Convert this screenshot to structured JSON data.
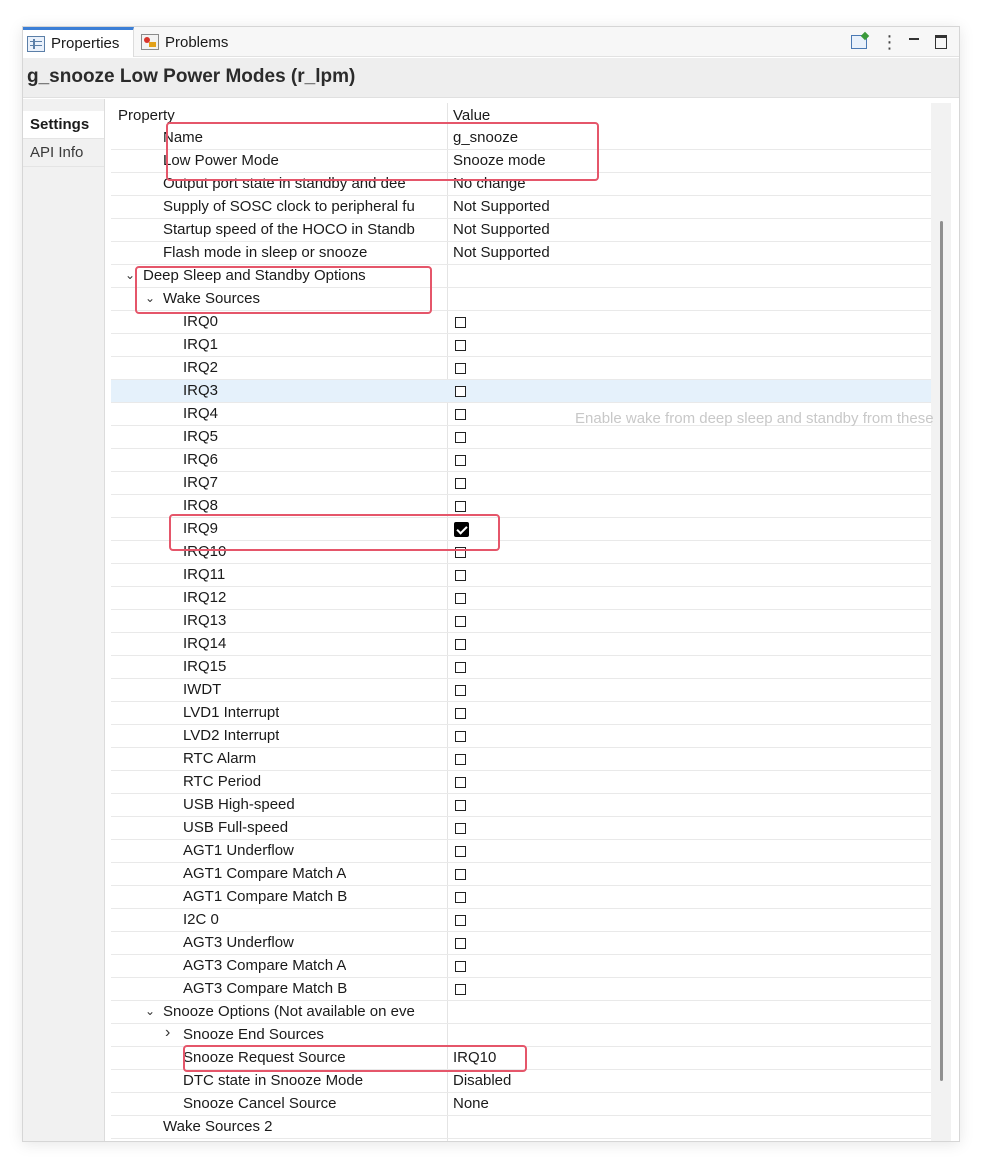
{
  "tabs": [
    {
      "label": "Properties",
      "active": true
    },
    {
      "label": "Problems",
      "active": false
    }
  ],
  "toolbar_icons": [
    "pin-to-editor-icon",
    "view-menu-icon",
    "minimize-icon",
    "maximize-icon"
  ],
  "header": {
    "title": "g_snooze Low Power Modes (r_lpm)"
  },
  "side_tabs": [
    {
      "label": "Settings",
      "active": true
    },
    {
      "label": "API Info",
      "active": false
    }
  ],
  "columns": {
    "property": "Property",
    "value": "Value"
  },
  "rows": [
    {
      "label": "Name",
      "value": "g_snooze",
      "indent": 1
    },
    {
      "label": "Low Power Mode",
      "value": "Snooze mode",
      "indent": 1
    },
    {
      "label": "Output port state in standby and dee",
      "value": "No change",
      "indent": 1
    },
    {
      "label": "Supply of SOSC clock to peripheral fu",
      "value": "Not Supported",
      "indent": 1
    },
    {
      "label": "Startup speed of the HOCO in Standb",
      "value": "Not Supported",
      "indent": 1
    },
    {
      "label": "Flash mode in sleep or snooze",
      "value": "Not Supported",
      "indent": 1
    },
    {
      "label": "Deep Sleep and Standby Options",
      "indent": 0,
      "chevron": "expanded"
    },
    {
      "label": "Wake Sources",
      "indent": 1,
      "chevron": "expanded"
    },
    {
      "label": "IRQ0",
      "indent": 2,
      "checkbox": false
    },
    {
      "label": "IRQ1",
      "indent": 2,
      "checkbox": false
    },
    {
      "label": "IRQ2",
      "indent": 2,
      "checkbox": false
    },
    {
      "label": "IRQ3",
      "indent": 2,
      "checkbox": false,
      "hover": true
    },
    {
      "label": "IRQ4",
      "indent": 2,
      "checkbox": false
    },
    {
      "label": "IRQ5",
      "indent": 2,
      "checkbox": false
    },
    {
      "label": "IRQ6",
      "indent": 2,
      "checkbox": false
    },
    {
      "label": "IRQ7",
      "indent": 2,
      "checkbox": false
    },
    {
      "label": "IRQ8",
      "indent": 2,
      "checkbox": false
    },
    {
      "label": "IRQ9",
      "indent": 2,
      "checkbox": true
    },
    {
      "label": "IRQ10",
      "indent": 2,
      "checkbox": false
    },
    {
      "label": "IRQ11",
      "indent": 2,
      "checkbox": false
    },
    {
      "label": "IRQ12",
      "indent": 2,
      "checkbox": false
    },
    {
      "label": "IRQ13",
      "indent": 2,
      "checkbox": false
    },
    {
      "label": "IRQ14",
      "indent": 2,
      "checkbox": false
    },
    {
      "label": "IRQ15",
      "indent": 2,
      "checkbox": false
    },
    {
      "label": "IWDT",
      "indent": 2,
      "checkbox": false
    },
    {
      "label": "LVD1 Interrupt",
      "indent": 2,
      "checkbox": false
    },
    {
      "label": "LVD2 Interrupt",
      "indent": 2,
      "checkbox": false
    },
    {
      "label": "RTC Alarm",
      "indent": 2,
      "checkbox": false
    },
    {
      "label": "RTC Period",
      "indent": 2,
      "checkbox": false
    },
    {
      "label": "USB High-speed",
      "indent": 2,
      "checkbox": false
    },
    {
      "label": "USB Full-speed",
      "indent": 2,
      "checkbox": false
    },
    {
      "label": "AGT1 Underflow",
      "indent": 2,
      "checkbox": false
    },
    {
      "label": "AGT1 Compare Match A",
      "indent": 2,
      "checkbox": false
    },
    {
      "label": "AGT1 Compare Match B",
      "indent": 2,
      "checkbox": false
    },
    {
      "label": "I2C 0",
      "indent": 2,
      "checkbox": false
    },
    {
      "label": "AGT3 Underflow",
      "indent": 2,
      "checkbox": false
    },
    {
      "label": "AGT3 Compare Match A",
      "indent": 2,
      "checkbox": false
    },
    {
      "label": "AGT3 Compare Match B",
      "indent": 2,
      "checkbox": false
    },
    {
      "label": "Snooze Options (Not available on eve",
      "indent": 1,
      "chevron": "expanded"
    },
    {
      "label": "Snooze End Sources",
      "indent": 2,
      "chevron": "collapsed"
    },
    {
      "label": "Snooze Request Source",
      "value": "IRQ10",
      "indent": 2
    },
    {
      "label": "DTC state in Snooze Mode",
      "value": "Disabled",
      "indent": 2
    },
    {
      "label": "Snooze Cancel Source",
      "value": "None",
      "indent": 2
    },
    {
      "label": "Wake Sources 2",
      "indent": 1
    }
  ],
  "tooltip": "Enable wake from deep sleep and standby from these",
  "highlight_color": "#e5566a",
  "hover_color": "#e5f1fb",
  "accent_color": "#3c7fd6"
}
